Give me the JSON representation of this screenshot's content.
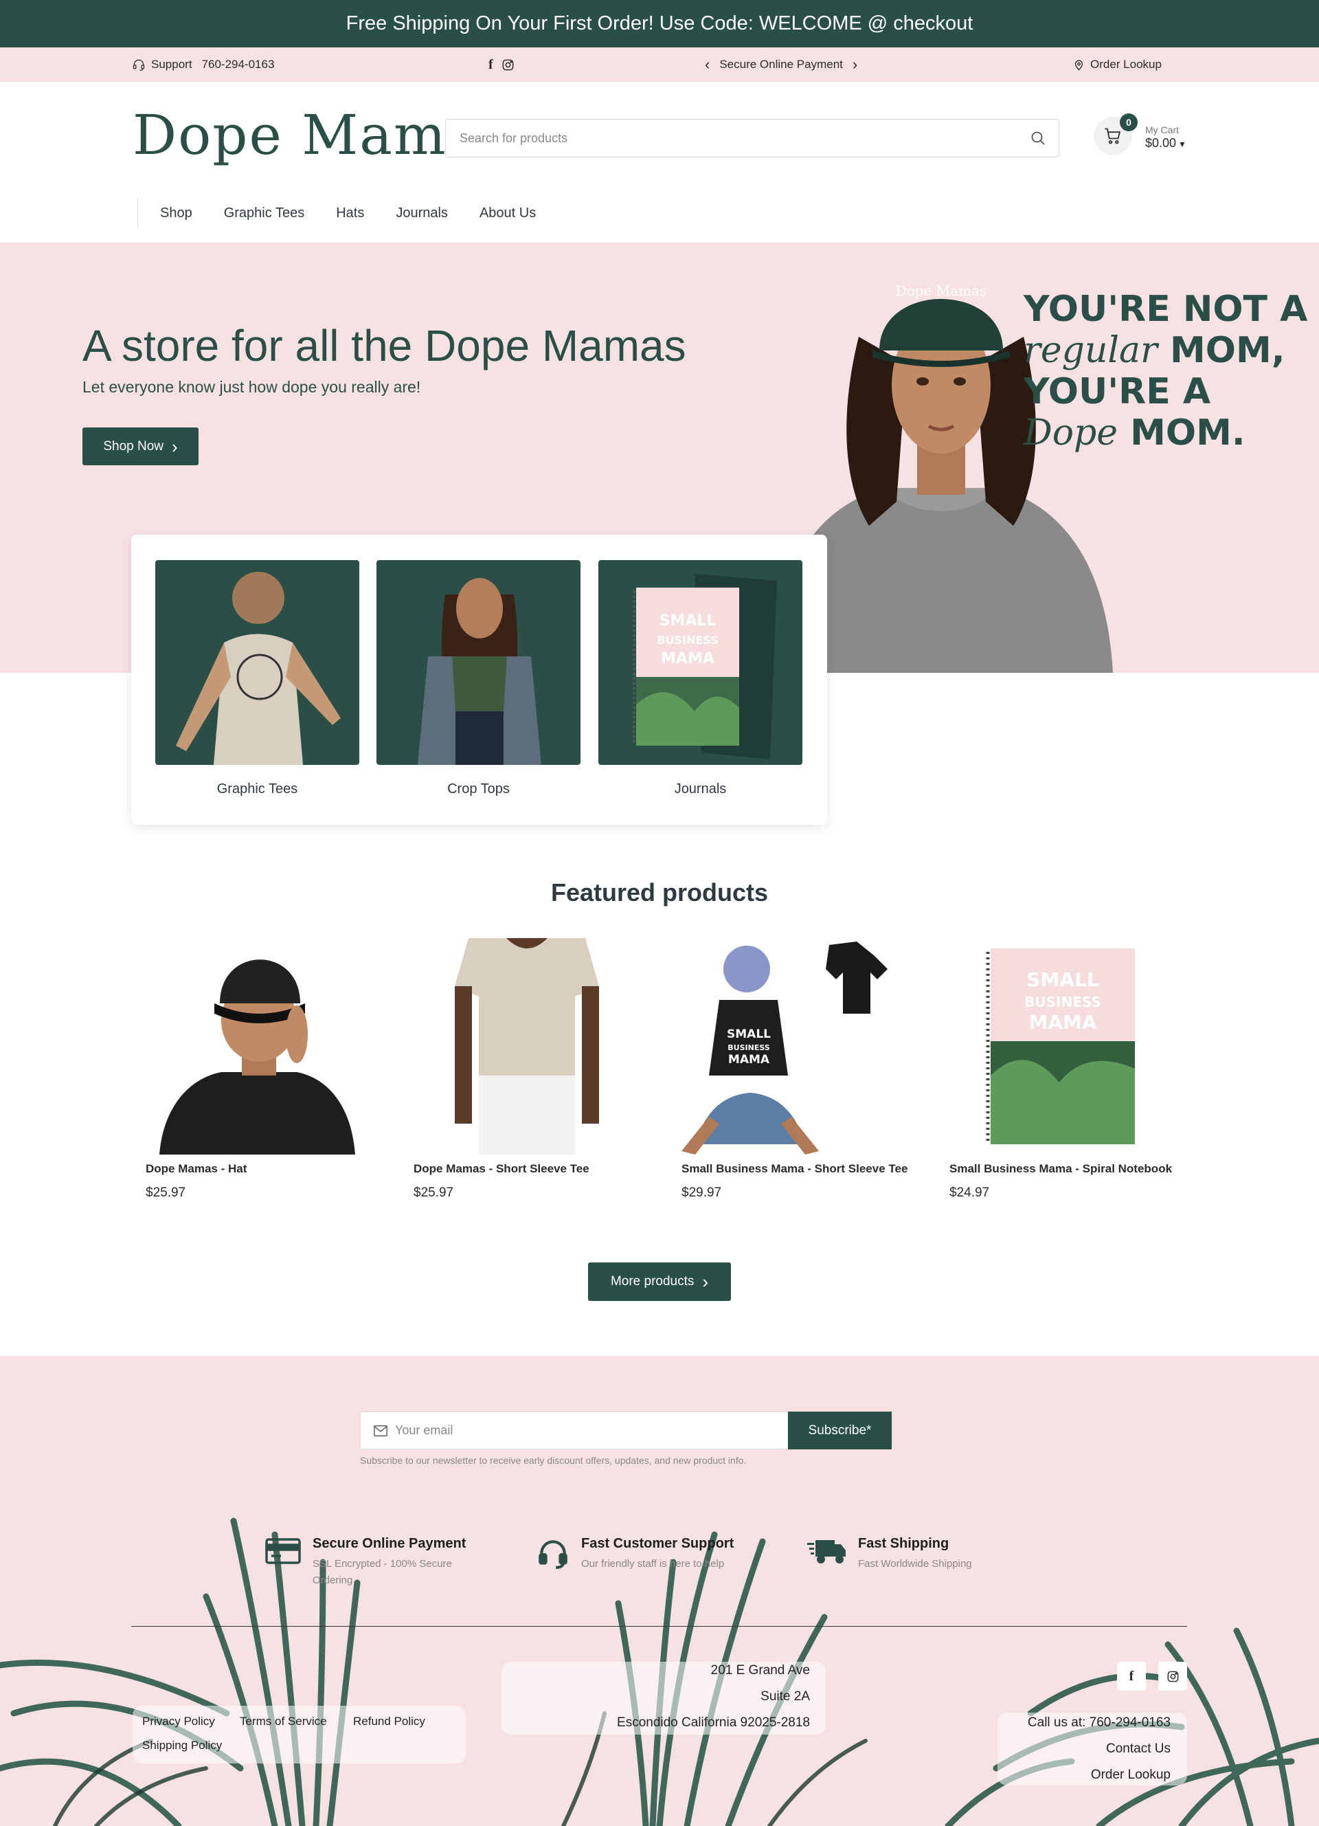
{
  "announcement": "Free Shipping On Your First Order! Use Code: WELCOME @ checkout",
  "utility": {
    "support_label": "Support",
    "support_phone": "760-294-0163",
    "payment_label": "Secure Online Payment",
    "order_lookup": "Order Lookup"
  },
  "header": {
    "logo_text": "Dope Mamas",
    "search_placeholder": "Search for products",
    "cart_count": "0",
    "cart_label": "My Cart",
    "cart_total": "$0.00"
  },
  "nav": [
    "Shop",
    "Graphic Tees",
    "Hats",
    "Journals",
    "About Us"
  ],
  "hero": {
    "title": "A store for all the Dope Mamas",
    "subtitle": "Let everyone know just how dope you really are!",
    "button": "Shop Now",
    "hat_text": "Dope Mamas",
    "quote": {
      "line1": "YOU'RE NOT A",
      "line2_script": "regular",
      "line2_rest": "MOM,",
      "line3": "YOU'RE A",
      "line4_script": "Dope",
      "line4_rest": "MOM."
    }
  },
  "categories": [
    "Graphic Tees",
    "Crop Tops",
    "Journals"
  ],
  "featured": {
    "title": "Featured products",
    "products": [
      {
        "name": "Dope Mamas - Hat",
        "price": "$25.97"
      },
      {
        "name": "Dope Mamas - Short Sleeve Tee",
        "price": "$25.97"
      },
      {
        "name": "Small Business Mama - Short Sleeve Tee",
        "price": "$29.97"
      },
      {
        "name": "Small Business Mama - Spiral Notebook",
        "price": "$24.97"
      }
    ],
    "more_button": "More products"
  },
  "newsletter": {
    "placeholder": "Your email",
    "button": "Subscribe*",
    "note": "Subscribe to our newsletter to receive early discount offers, updates, and new product info."
  },
  "features": [
    {
      "title": "Secure Online Payment",
      "sub1": "SSL Encrypted - 100% Secure",
      "sub2": "Ordering"
    },
    {
      "title": "Fast Customer Support",
      "sub1": "Our friendly staff is here to help"
    },
    {
      "title": "Fast Shipping",
      "sub1": "Fast Worldwide Shipping"
    }
  ],
  "footer": {
    "links": [
      "Privacy Policy",
      "Terms of Service",
      "Refund Policy",
      "Shipping Policy"
    ],
    "address": [
      "201 E Grand Ave",
      "Suite 2A",
      "Escondido California 92025-2818"
    ],
    "call": "Call us at: 760-294-0163",
    "contact": "Contact Us",
    "order_lookup": "Order Lookup"
  },
  "product_art": {
    "tee_text_small": "SMALL",
    "tee_text_business": "BUSINESS",
    "tee_text_mama": "MAMA"
  },
  "colors": {
    "brand_green": "#2a4f47",
    "pink": "#f8e1e2"
  }
}
